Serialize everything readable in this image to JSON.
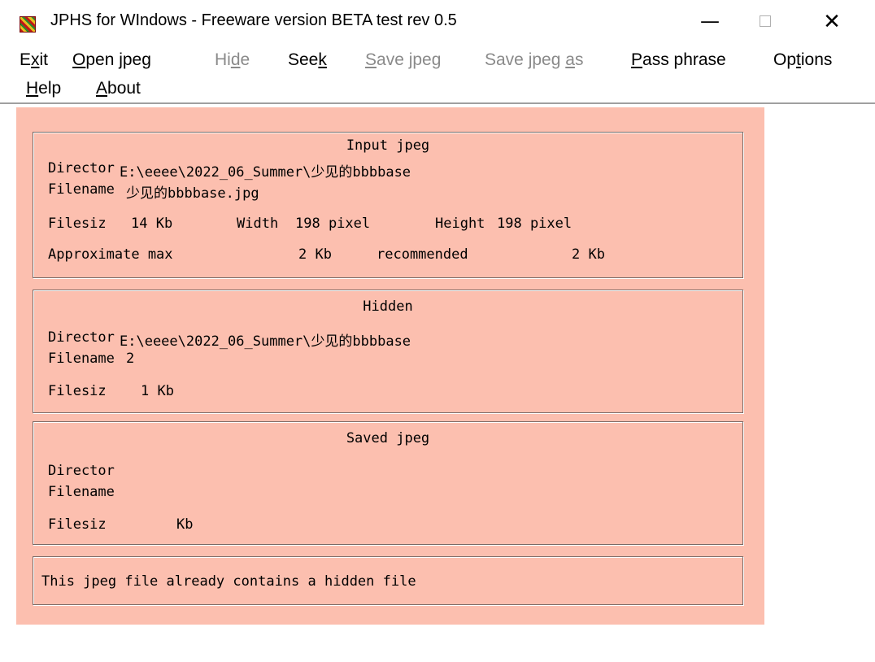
{
  "window": {
    "title": "JPHS for WIndows - Freeware version BETA test rev 0.5",
    "icon": "jphs-app-icon",
    "min_glyph": "—",
    "close_glyph": "✕"
  },
  "menu": {
    "exit": {
      "pre": "E",
      "u": "x",
      "post": "it"
    },
    "open": {
      "pre": "",
      "u": "O",
      "post": "pen jpeg"
    },
    "hide": {
      "pre": "Hi",
      "u": "d",
      "post": "e"
    },
    "seek": {
      "pre": "See",
      "u": "k",
      "post": ""
    },
    "save": {
      "pre": "",
      "u": "S",
      "post": "ave jpeg"
    },
    "saveas": {
      "pre": "Save jpeg ",
      "u": "a",
      "post": "s"
    },
    "pass": {
      "pre": "",
      "u": "P",
      "post": "ass phrase"
    },
    "options": {
      "pre": "Op",
      "u": "t",
      "post": "ions"
    },
    "help": {
      "pre": "",
      "u": "H",
      "post": "elp"
    },
    "about": {
      "pre": "",
      "u": "A",
      "post": "bout"
    }
  },
  "input_jpeg": {
    "heading": "Input jpeg",
    "dir_label": "Director",
    "dir_value": "E:\\eeee\\2022_06_Summer\\少见的bbbbase",
    "file_label": "Filename",
    "file_value": "少见的bbbbase.jpg",
    "size_label": "Filesiz",
    "size_value": "14 Kb",
    "width_label": "Width",
    "width_value": "198 pixel",
    "height_label": "Height",
    "height_value": "198 pixel",
    "approx_label": "Approximate max",
    "approx_value": "2 Kb",
    "rec_label": "recommended",
    "rec_value": "2 Kb"
  },
  "hidden": {
    "heading": "Hidden",
    "dir_label": "Director",
    "dir_value": "E:\\eeee\\2022_06_Summer\\少见的bbbbase",
    "file_label": "Filename",
    "file_value": "2",
    "size_label": "Filesiz",
    "size_value": "1 Kb"
  },
  "saved_jpeg": {
    "heading": "Saved jpeg",
    "dir_label": "Director",
    "file_label": "Filename",
    "size_label": "Filesiz",
    "size_value": "Kb"
  },
  "status": {
    "message": "This jpeg file already contains a hidden file"
  },
  "colors": {
    "panel": "#fcbfaf",
    "disabled_menu": "#8a8a8a"
  }
}
